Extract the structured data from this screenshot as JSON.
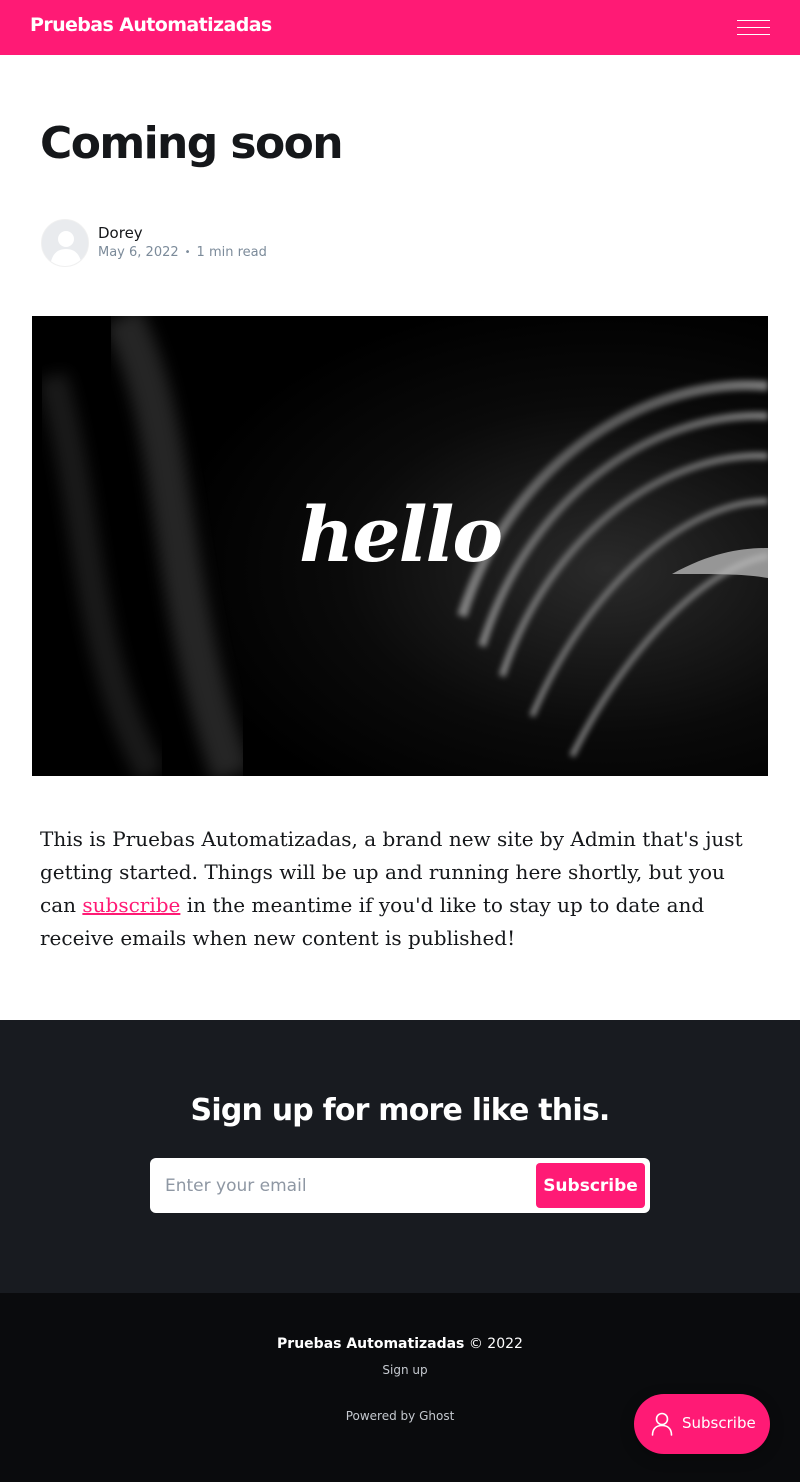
{
  "header": {
    "site_title": "Pruebas Automatizadas",
    "menu_icon": "hamburger-menu-icon",
    "background": "#ff1a75"
  },
  "article": {
    "title": "Coming soon",
    "author": "Dorey",
    "date": "May 6, 2022",
    "separator": "•",
    "reading_time": "1 min read",
    "image_text": "hello",
    "body_before_link": "This is Pruebas Automatizadas, a brand new site by Admin that's just getting started. Things will be up and running here shortly, but you can ",
    "body_link": "subscribe",
    "body_after_link": " in the meantime if you'd like to stay up to date and receive emails when new content is published!"
  },
  "cta": {
    "title": "Sign up for more like this.",
    "email_placeholder": "Enter your email",
    "button_label": "Subscribe"
  },
  "footer": {
    "site_name": "Pruebas Automatizadas",
    "copyright_suffix": "© 2022",
    "nav_signup": "Sign up",
    "powered_by": "Powered by Ghost"
  },
  "portal": {
    "label": "Subscribe",
    "icon": "user-icon"
  },
  "colors": {
    "accent": "#ff1a75",
    "dark_section": "#181b20",
    "footer": "#0a0b0d"
  }
}
